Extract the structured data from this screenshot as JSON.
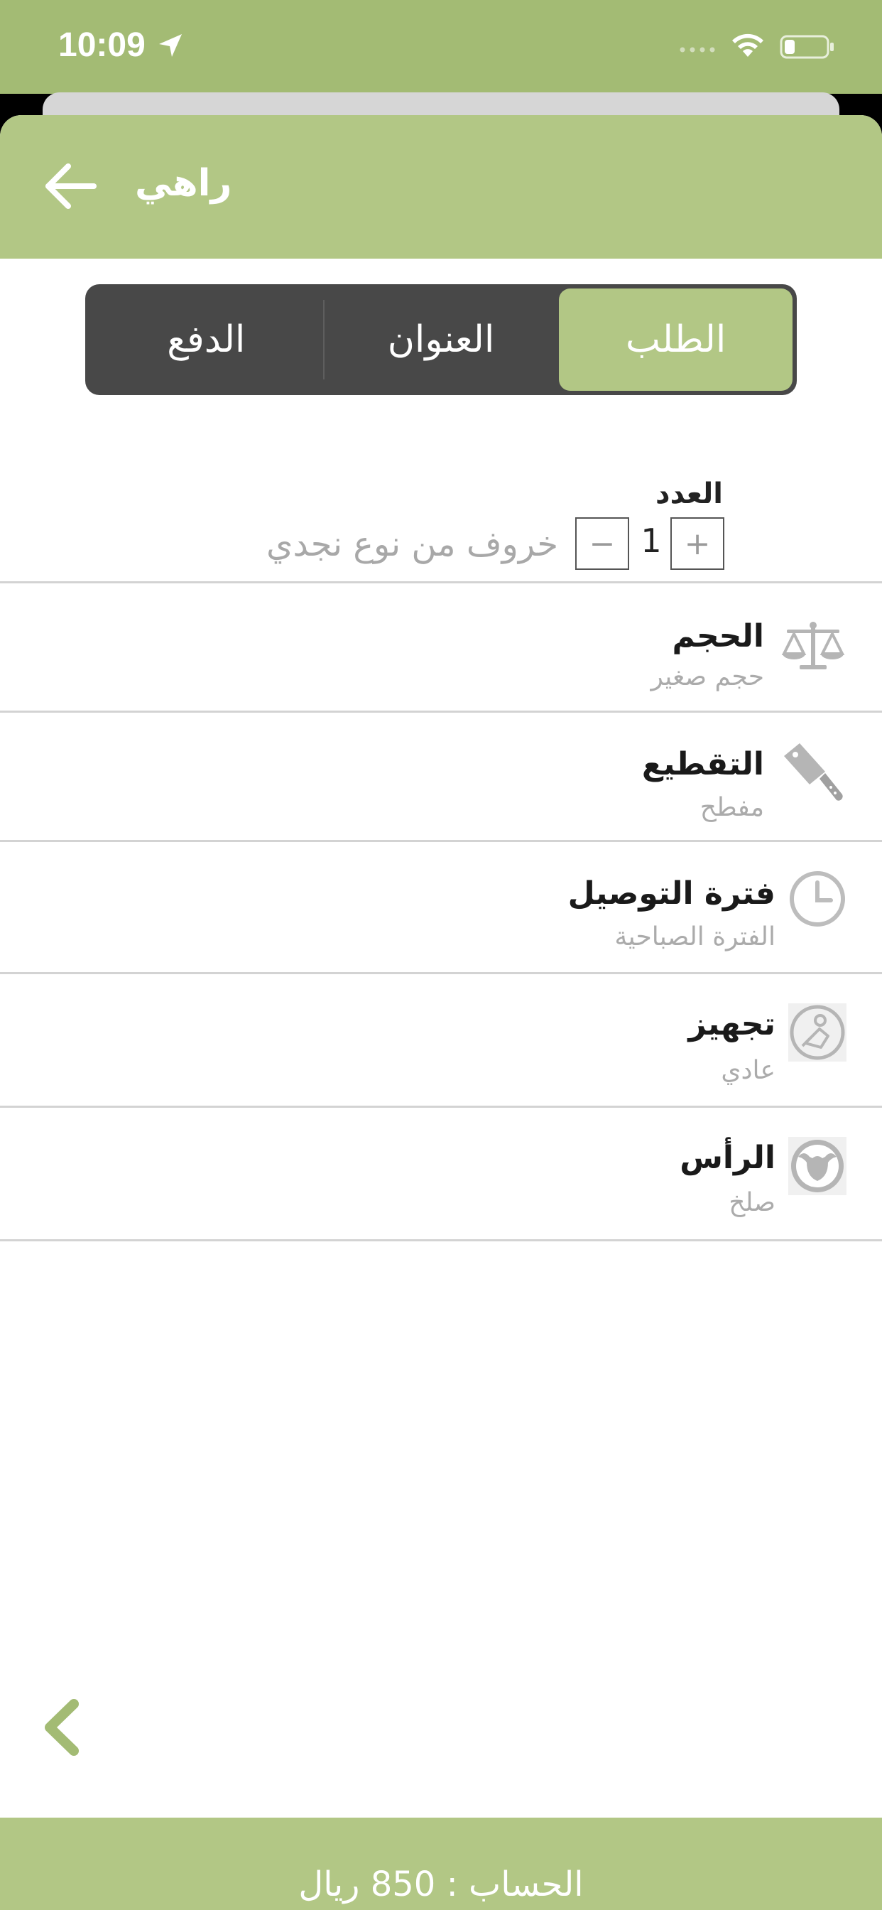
{
  "status_bar": {
    "time": "10:09"
  },
  "header": {
    "title": "راهي"
  },
  "tabs": [
    {
      "label": "الطلب",
      "active": true
    },
    {
      "label": "العنوان",
      "active": false
    },
    {
      "label": "الدفع",
      "active": false
    }
  ],
  "quantity": {
    "label": "العدد",
    "value": "1",
    "plus": "+",
    "minus": "−",
    "product": "خروف من نوع نجدي"
  },
  "options": [
    {
      "title": "الحجم",
      "value": "حجم صغير",
      "icon": "scale-icon"
    },
    {
      "title": "التقطيع",
      "value": "مفطح",
      "icon": "cleaver-icon"
    },
    {
      "title": "فترة التوصيل",
      "value": "الفترة الصباحية",
      "icon": "clock-icon"
    },
    {
      "title": "تجهيز",
      "value": "عادي",
      "icon": "chef-icon"
    },
    {
      "title": "الرأس",
      "value": "صلخ",
      "icon": "animal-head-icon"
    }
  ],
  "total": {
    "text": "الحساب : 850 ريال"
  },
  "colors": {
    "accent": "#b2c785",
    "status_bar": "#a3bb74",
    "tab_bg": "#484848"
  }
}
